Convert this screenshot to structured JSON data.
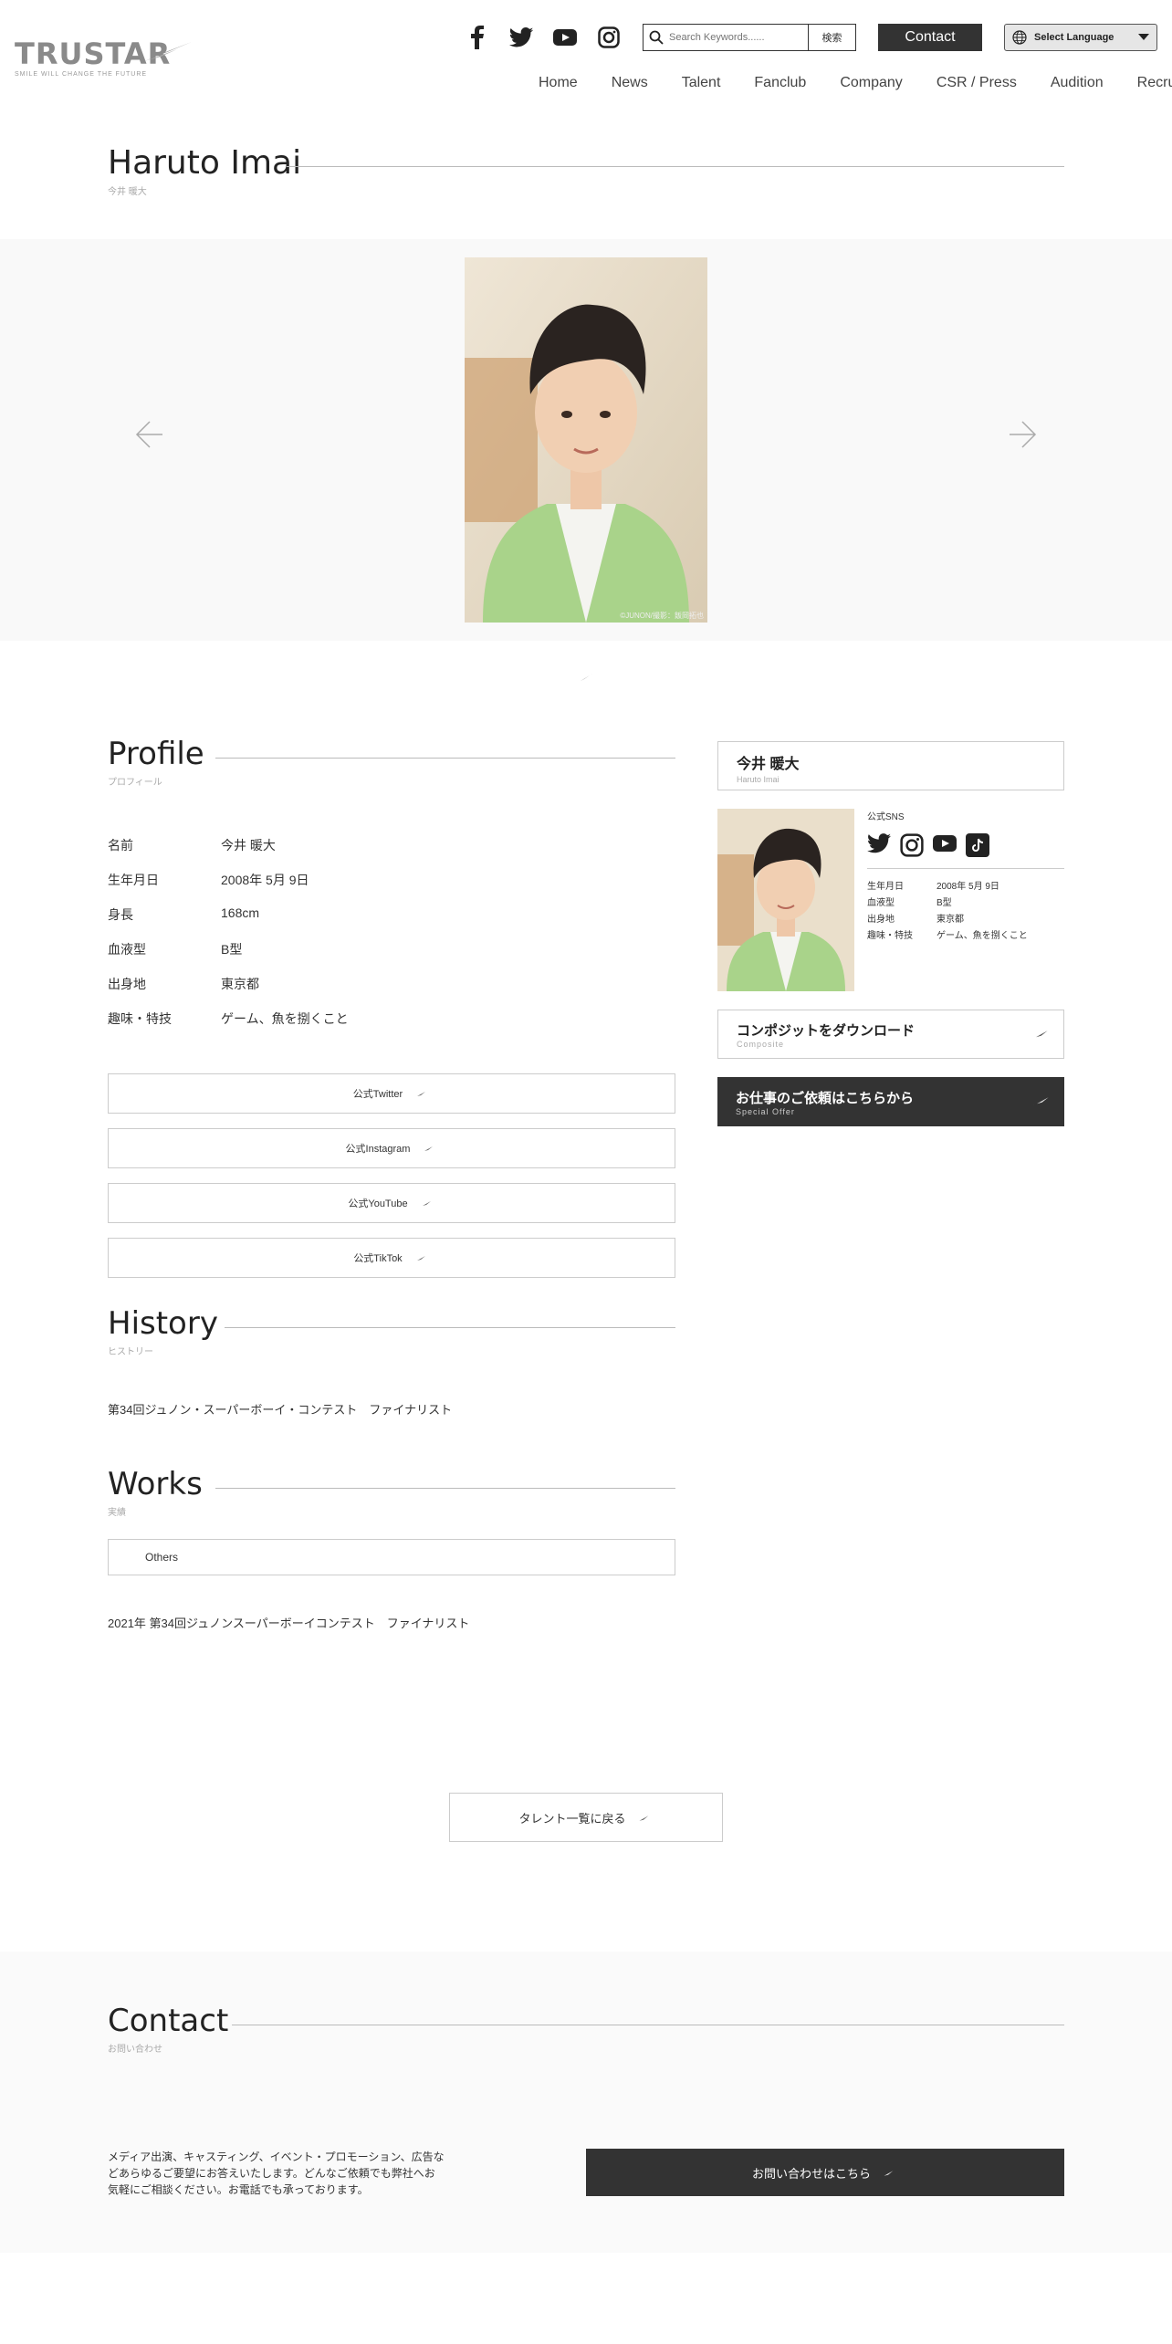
{
  "header": {
    "logo": "TRUSTAR",
    "tagline": "SMILE WILL CHANGE THE FUTURE",
    "search_placeholder": "Search Keywords......",
    "search_button": "検索",
    "contact_button": "Contact",
    "language_select": "Select Language",
    "nav": [
      "Home",
      "News",
      "Talent",
      "Fanclub",
      "Company",
      "CSR / Press",
      "Audition",
      "Recruit"
    ]
  },
  "page": {
    "title": "Haruto Imai",
    "subtitle": "今井 暖大"
  },
  "gallery": {
    "credit": "©JUNON/撮影：飯岡拓也"
  },
  "profile": {
    "title": "Profile",
    "subtitle": "プロフィール",
    "rows": [
      {
        "k": "名前",
        "v": "今井 暖大"
      },
      {
        "k": "生年月日",
        "v": "2008年 5月 9日"
      },
      {
        "k": "身長",
        "v": "168cm"
      },
      {
        "k": "血液型",
        "v": "B型"
      },
      {
        "k": "出身地",
        "v": "東京都"
      },
      {
        "k": "趣味・特技",
        "v": "ゲーム、魚を捌くこと"
      }
    ],
    "sns_buttons": [
      "公式Twitter",
      "公式Instagram",
      "公式YouTube",
      "公式TikTok"
    ]
  },
  "history": {
    "title": "History",
    "subtitle": "ヒストリー",
    "text": "第34回ジュノン・スーパーボーイ・コンテスト　ファイナリスト"
  },
  "works": {
    "title": "Works",
    "subtitle": "実績",
    "tab": "Others",
    "text": "2021年 第34回ジュノンスーパーボーイコンテスト　ファイナリスト"
  },
  "sidebar": {
    "name": "今井 暖大",
    "name_en": "Haruto Imai",
    "sns_label": "公式SNS",
    "rows": [
      {
        "k": "生年月日",
        "v": "2008年 5月 9日"
      },
      {
        "k": "血液型",
        "v": "B型"
      },
      {
        "k": "出身地",
        "v": "東京都"
      },
      {
        "k": "趣味・特技",
        "v": "ゲーム、魚を捌くこと"
      }
    ],
    "composite_title": "コンポジットをダウンロード",
    "composite_sub": "Composite",
    "offer_title": "お仕事のご依頼はこちらから",
    "offer_sub": "Special Offer"
  },
  "back_button": "タレント一覧に戻る",
  "contact": {
    "title": "Contact",
    "subtitle": "お問い合わせ",
    "text": "メディア出演、キャスティング、イベント・プロモーション、広告などあらゆるご要望にお答えいたします。どんなご依頼でも弊社へお気軽にご相談ください。お電話でも承っております。",
    "button": "お問い合わせはこちら"
  },
  "colors": {
    "dark": "#333333",
    "line": "#bbbbbb",
    "sub": "#aaaaaa",
    "bg_soft": "#f9f9f9"
  }
}
